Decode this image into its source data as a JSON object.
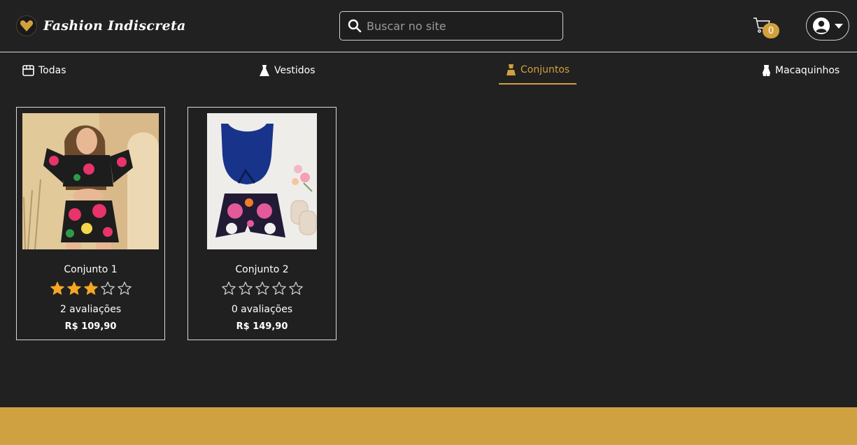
{
  "header": {
    "brand_name": "Fashion Indiscreta",
    "search_placeholder": "Buscar no site",
    "cart_count": "0"
  },
  "tabs": [
    {
      "label": "Todas",
      "icon": "store-icon",
      "active": false
    },
    {
      "label": "Vestidos",
      "icon": "dress-icon",
      "active": false
    },
    {
      "label": "Conjuntos",
      "icon": "outfit-icon",
      "active": true
    },
    {
      "label": "Macaquinhos",
      "icon": "romper-icon",
      "active": false
    }
  ],
  "products": [
    {
      "name": "Conjunto 1",
      "rating": 3,
      "max_rating": 5,
      "reviews": "2 avaliações",
      "price": "R$ 109,90"
    },
    {
      "name": "Conjunto 2",
      "rating": 0,
      "max_rating": 5,
      "reviews": "0 avaliações",
      "price": "R$ 149,90"
    }
  ],
  "colors": {
    "background": "#212121",
    "accent": "#d2a13c",
    "star_filled": "#f5a623",
    "footer": "#cfa140"
  }
}
